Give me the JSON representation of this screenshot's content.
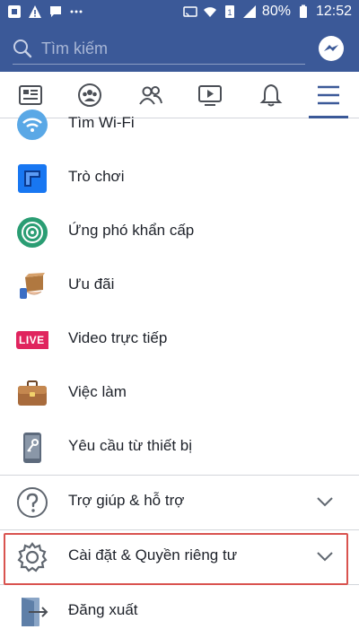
{
  "status": {
    "battery": "80%",
    "time": "12:52"
  },
  "search": {
    "placeholder": "Tìm kiếm"
  },
  "nav": {
    "items": [
      "news-feed-icon",
      "groups-icon",
      "friends-icon",
      "watch-icon",
      "notifications-icon",
      "menu-icon"
    ]
  },
  "menu": {
    "wifi": "Tìm Wi-Fi",
    "games": "Trò chơi",
    "crisis": "Ứng phó khẩn cấp",
    "offers": "Ưu đãi",
    "live": "Video trực tiếp",
    "live_badge": "LIVE",
    "jobs": "Việc làm",
    "device": "Yêu cầu từ thiết bị",
    "help": "Trợ giúp & hỗ trợ",
    "settings": "Cài đặt & Quyền riêng tư",
    "logout": "Đăng xuất"
  },
  "colors": {
    "brand": "#3b5998",
    "highlight": "#d9534f",
    "live": "#e0245e"
  }
}
